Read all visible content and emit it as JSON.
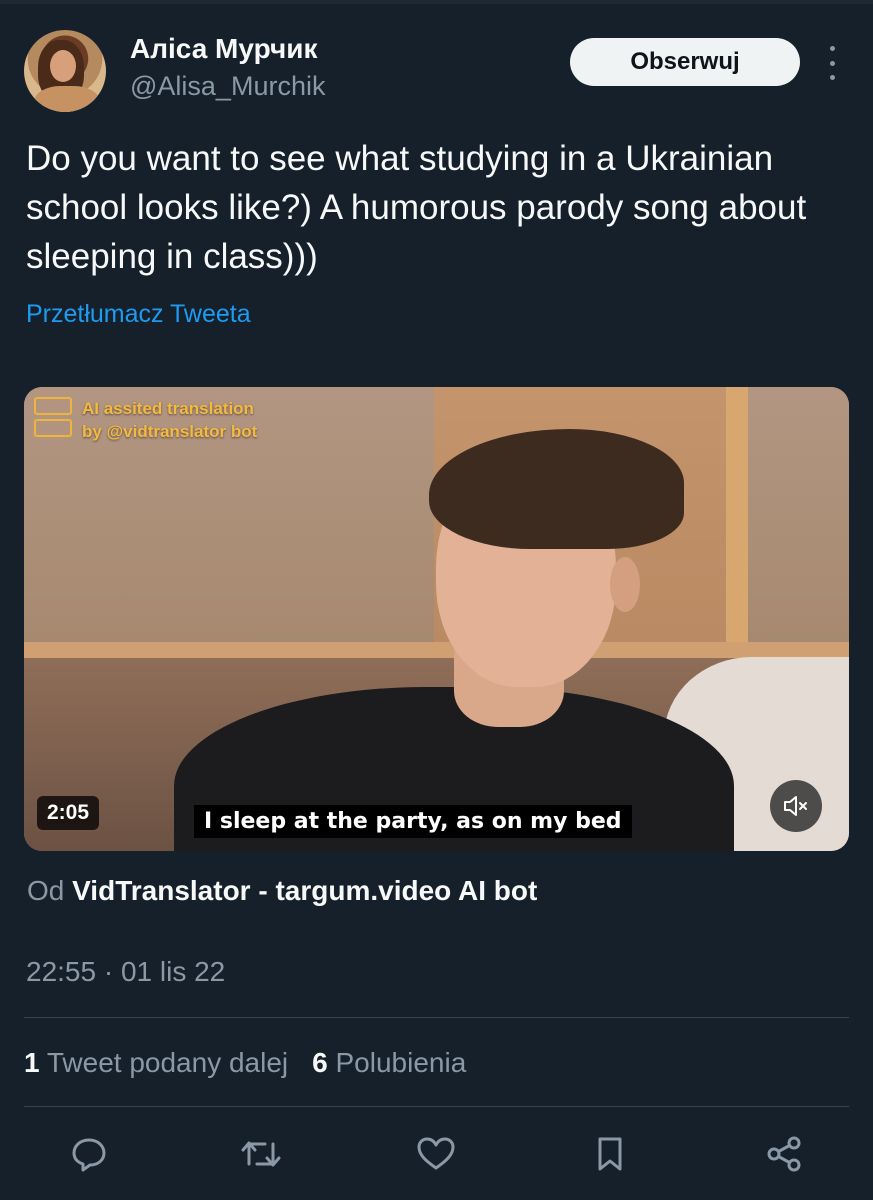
{
  "author": {
    "display_name": "Аліса Мурчик",
    "handle": "@Alisa_Murchik"
  },
  "follow_label": "Obserwuj",
  "tweet": {
    "text": "Do you want to see what studying in a Ukrainian school looks like?) A humorous parody song about sleeping in class)))",
    "translate_label": "Przetłumacz Tweeta"
  },
  "video": {
    "brand_line1": "AI assited translation",
    "brand_line2": "by @vidtranslator bot",
    "duration": "2:05",
    "subtitle": "I sleep at the party, as on my bed"
  },
  "source": {
    "prefix": "Od",
    "name": "VidTranslator - targum.video AI bot"
  },
  "timestamp": "22:55 · 01 lis 22",
  "stats": {
    "retweets_count": "1",
    "retweets_label": "Tweet podany dalej",
    "likes_count": "6",
    "likes_label": "Polubienia"
  },
  "colors": {
    "background": "#15202b",
    "accent": "#1d9bf0",
    "secondary_text": "#8b98a5",
    "border": "#38444d"
  },
  "icons": [
    "more-icon",
    "mute-icon",
    "reply-icon",
    "retweet-icon",
    "like-icon",
    "bookmark-icon",
    "share-icon"
  ]
}
